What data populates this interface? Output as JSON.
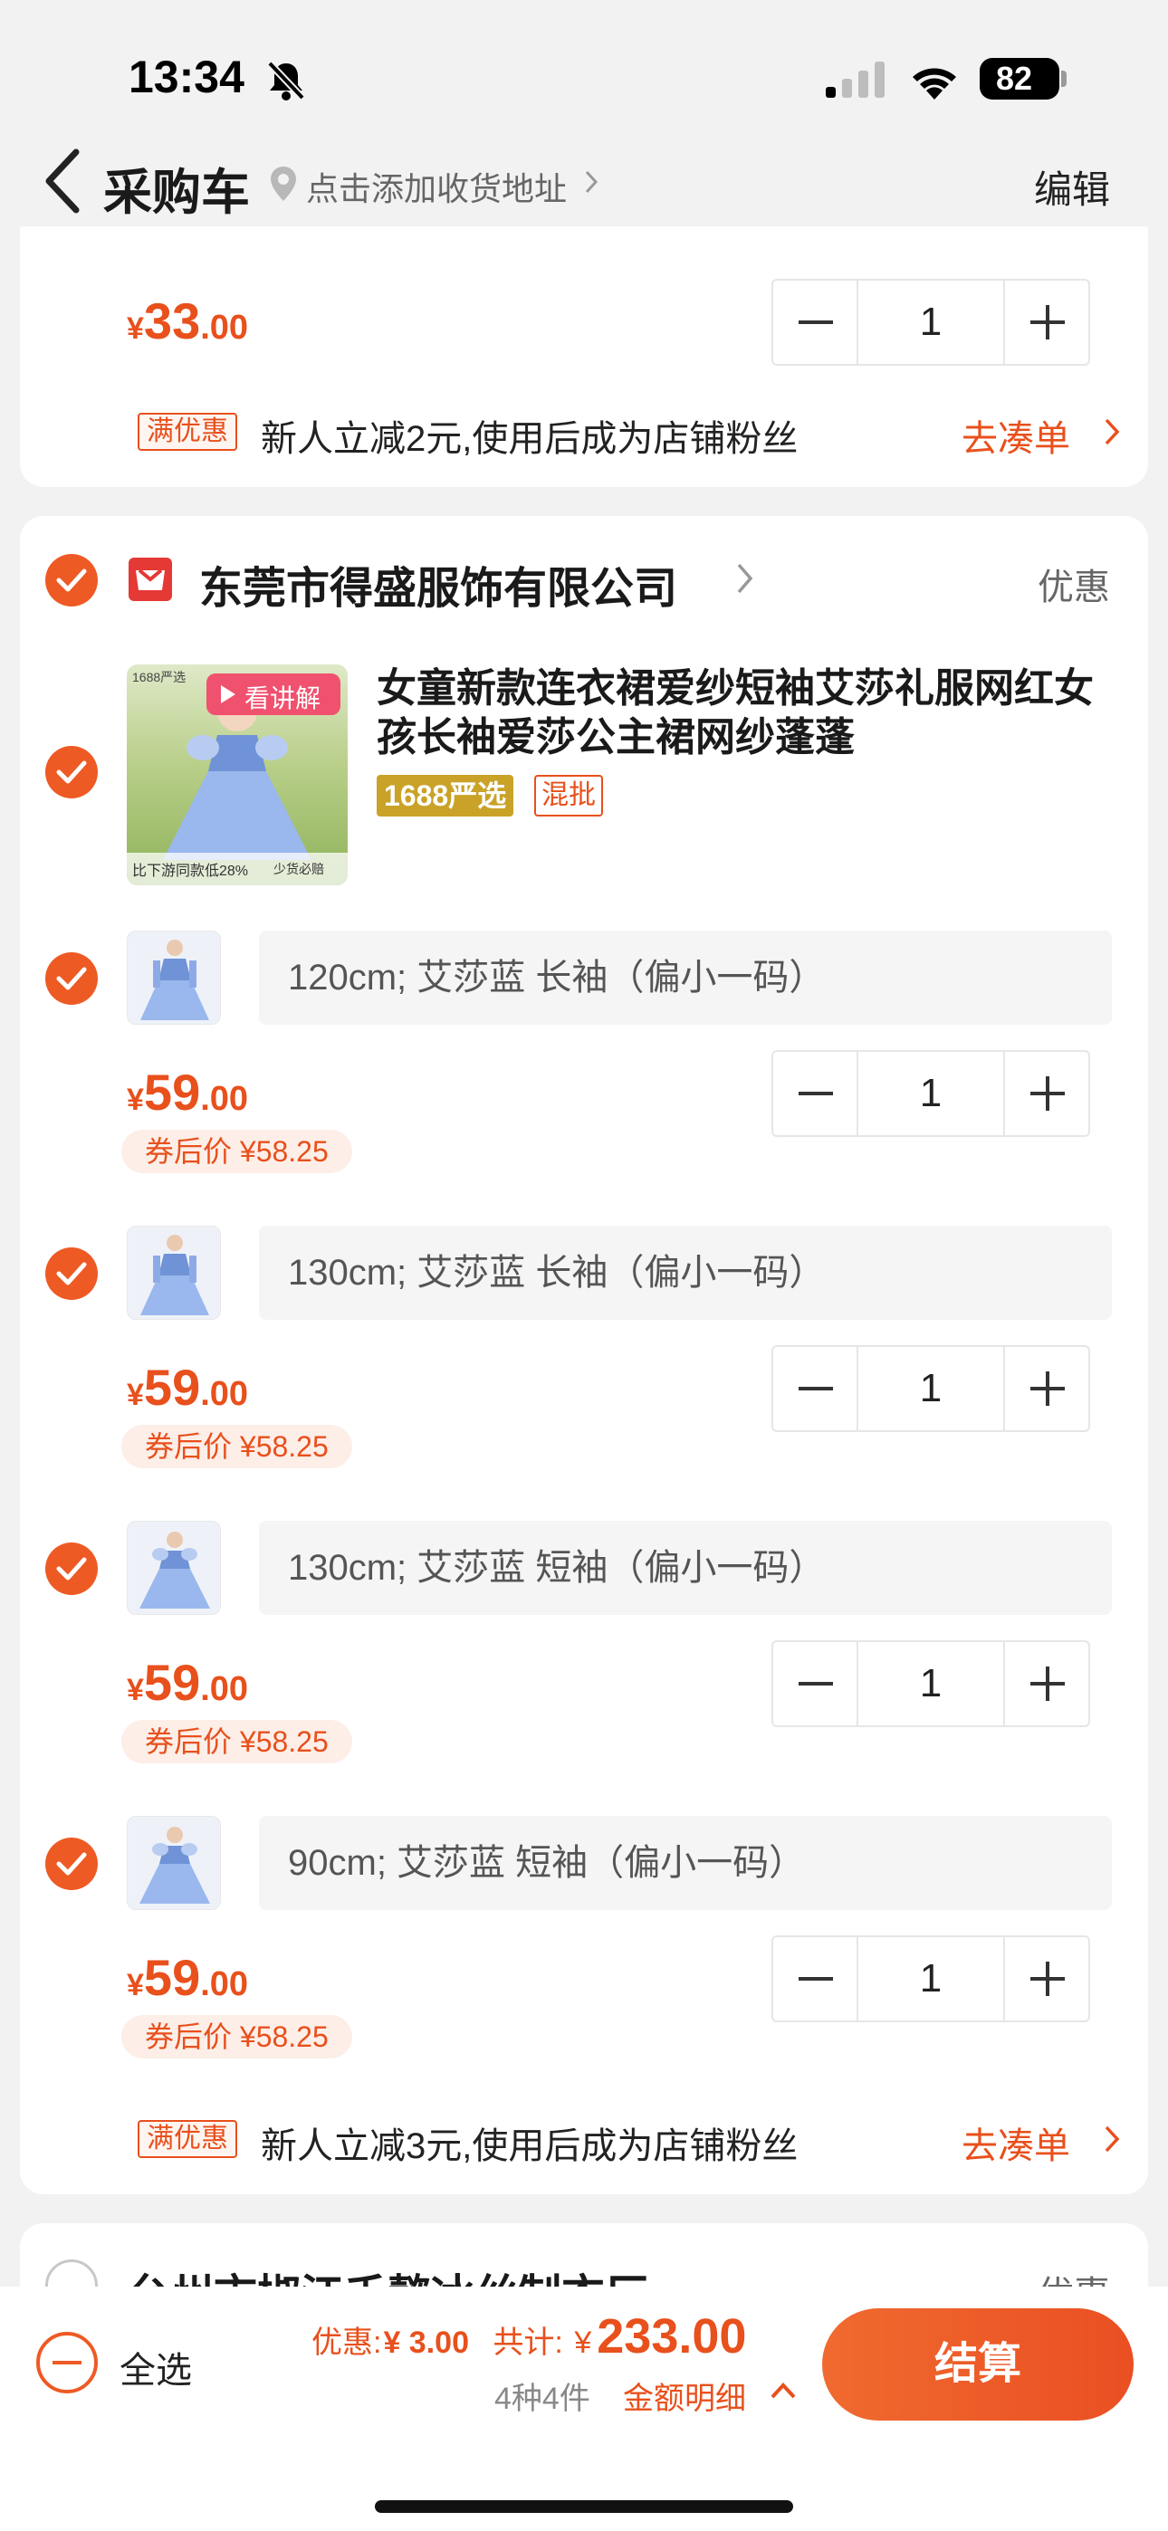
{
  "status_bar": {
    "time": "13:34",
    "battery": "82"
  },
  "nav": {
    "title": "采购车",
    "address_placeholder": "点击添加收货地址",
    "edit_label": "编辑"
  },
  "prev_shop": {
    "price": {
      "yen": "¥",
      "int": "33",
      "dec": ".00"
    },
    "quantity": "1",
    "promo": {
      "tag": "满优惠",
      "text": "新人立减2元,使用后成为店铺粉丝",
      "link": "去凑单"
    }
  },
  "shop": {
    "name": "东莞市得盛服饰有限公司",
    "discount_label": "优惠",
    "product": {
      "title": "女童新款连衣裙爱纱短袖艾莎礼服网红女孩长袖爱莎公主裙网纱蓬蓬",
      "badge_video": "看讲解",
      "badge_1688": "1688严选",
      "badge_mixed": "混批",
      "image_caption_left": "比下游同款低28%",
      "image_caption_right": "少货必赔",
      "image_corner": "1688严选"
    },
    "skus": [
      {
        "spec": "120cm; 艾莎蓝 长袖（偏小一码）",
        "yen": "¥",
        "int": "59",
        "dec": ".00",
        "quantity": "1",
        "coupon": "券后价 ¥58.25"
      },
      {
        "spec": "130cm; 艾莎蓝 长袖（偏小一码）",
        "yen": "¥",
        "int": "59",
        "dec": ".00",
        "quantity": "1",
        "coupon": "券后价 ¥58.25"
      },
      {
        "spec": "130cm; 艾莎蓝 短袖（偏小一码）",
        "yen": "¥",
        "int": "59",
        "dec": ".00",
        "quantity": "1",
        "coupon": "券后价 ¥58.25"
      },
      {
        "spec": "90cm; 艾莎蓝 短袖（偏小一码）",
        "yen": "¥",
        "int": "59",
        "dec": ".00",
        "quantity": "1",
        "coupon": "券后价 ¥58.25"
      }
    ],
    "promo": {
      "tag": "满优惠",
      "text": "新人立减3元,使用后成为店铺粉丝",
      "link": "去凑单"
    }
  },
  "next_shop": {
    "name": "台州市椒江千懿冰丝制衣厂",
    "discount_label": "优惠"
  },
  "bottom_bar": {
    "select_all": "全选",
    "discount_label": "优惠:",
    "discount_value": "¥ 3.00",
    "total_label": "共计:",
    "total_yen": "¥",
    "total_value": "233.00",
    "count_text": "4种4件",
    "detail_label": "金额明细",
    "checkout_label": "结算"
  },
  "colors": {
    "accent": "#ee5a24",
    "price": "#e8501c",
    "gold_badge": "#c9a227"
  }
}
